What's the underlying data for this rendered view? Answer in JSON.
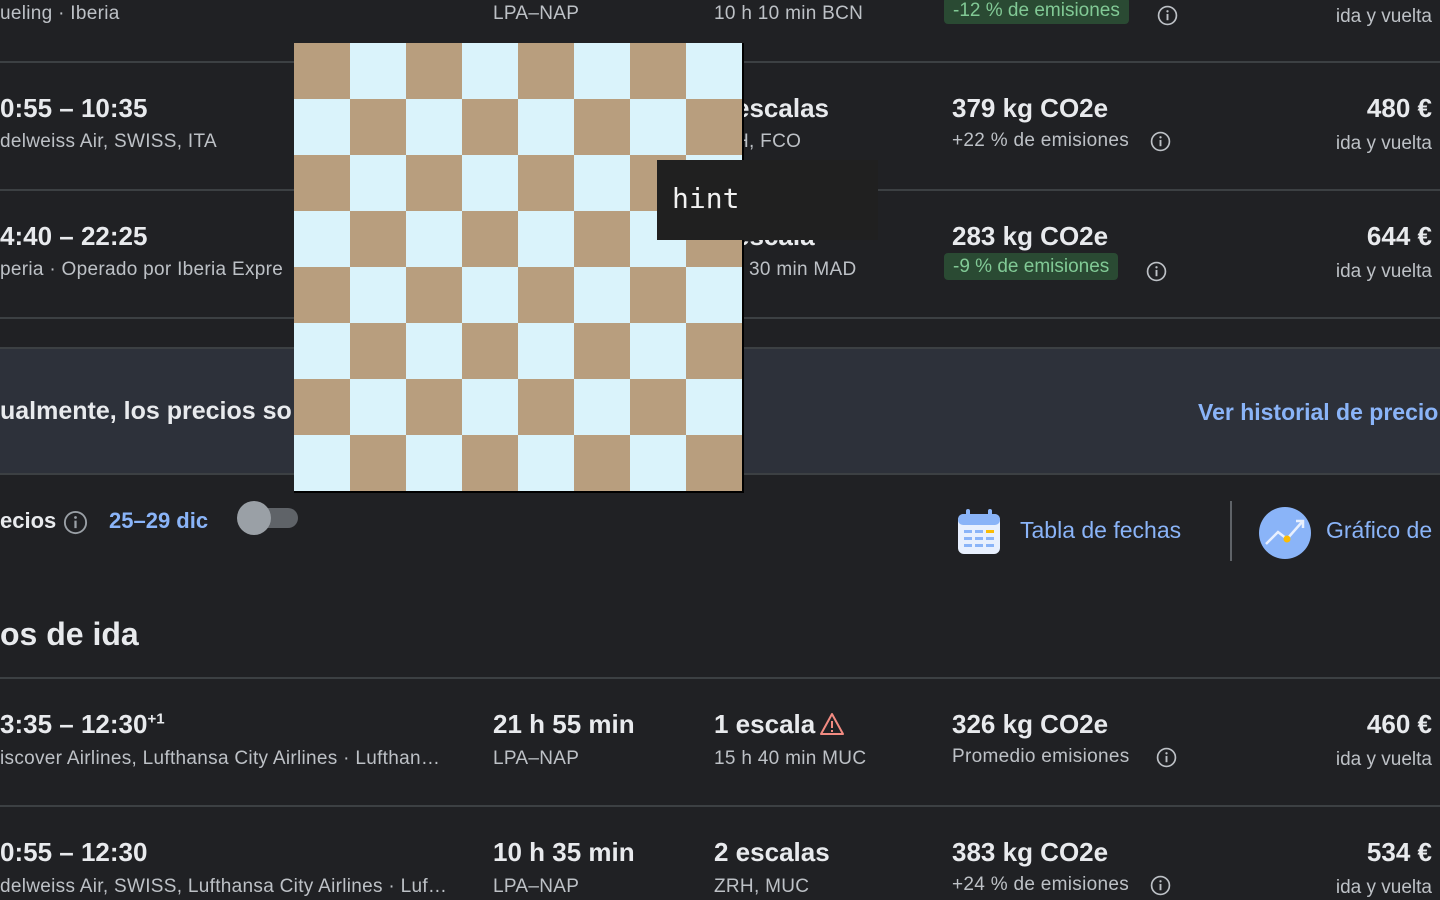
{
  "row0": {
    "airlines": "ueling · Iberia",
    "route": "LPA–NAP",
    "stops_detail": "10 h 10 min BCN",
    "emissions_badge": "-12 % de emisiones",
    "trip_type": "ida y vuelta"
  },
  "row1": {
    "times": "0:55 – 10:35",
    "airlines": "delweiss Air, SWISS, ITA",
    "stops": "escalas",
    "stops_detail": "H, FCO",
    "co2": "379 kg CO2e",
    "emissions": "+22 % de emisiones",
    "price": "480 €",
    "trip_type": "ida y vuelta"
  },
  "row2": {
    "times": "4:40 – 22:25",
    "airlines": "peria · Operado por Iberia Expre",
    "stops": "escala",
    "stops_detail": "30 min MAD",
    "co2": "283 kg CO2e",
    "emissions_badge": "-9 % de emisiones",
    "price": "644 €",
    "trip_type": "ida y vuelta"
  },
  "banner": {
    "text": "ualmente, los precios so",
    "link": "Ver historial de precio"
  },
  "controls": {
    "label": "ecios",
    "dates": "25–29 dic",
    "date_grid": "Tabla de fechas",
    "price_graph": "Gráfico de"
  },
  "section_title": "os de ida",
  "row3": {
    "times": "3:35 – 12:30",
    "times_sup": "+1",
    "airlines": "iscover Airlines, Lufthansa City Airlines · Lufthan…",
    "duration": "21 h 55 min",
    "route": "LPA–NAP",
    "stops": "1 escala",
    "stops_detail": "15 h 40 min MUC",
    "co2": "326 kg CO2e",
    "emissions": "Promedio emisiones",
    "price": "460 €",
    "trip_type": "ida y vuelta"
  },
  "row4": {
    "times": "0:55 – 12:30",
    "airlines": "delweiss Air, SWISS, Lufthansa City Airlines · Luf…",
    "duration": "10 h 35 min",
    "route": "LPA–NAP",
    "stops": "2 escalas",
    "stops_detail": "ZRH, MUC",
    "co2": "383 kg CO2e",
    "emissions": "+24 % de emisiones",
    "price": "534 €",
    "trip_type": "ida y vuelta"
  },
  "tooltip": "hint",
  "colors": {
    "background": "#202124",
    "banner": "#2d313a",
    "accent_blue": "#8ab4f8",
    "green_badge_bg": "#2a4a33",
    "green_text": "#81c995",
    "warning": "#f28b82"
  }
}
